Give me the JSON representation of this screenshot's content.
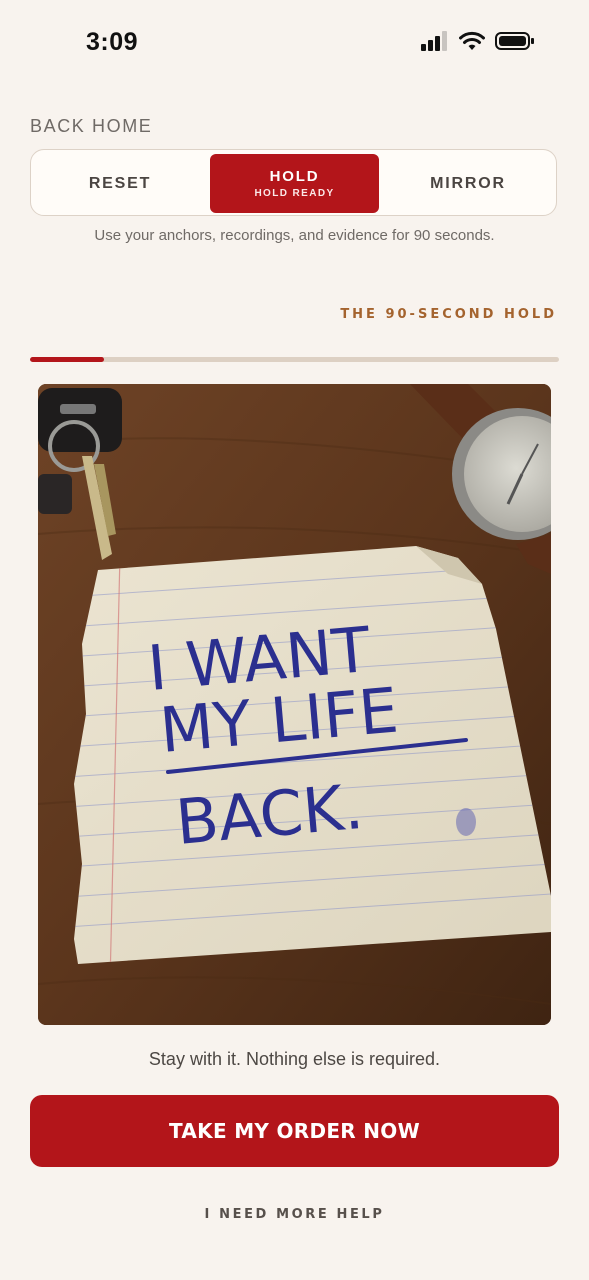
{
  "status_bar": {
    "time": "3:09"
  },
  "nav": {
    "back_label": "BACK HOME"
  },
  "modes": {
    "reset_label": "RESET",
    "hold_label": "HOLD",
    "hold_status": "HOLD READY",
    "mirror_label": "MIRROR",
    "selected": "HOLD"
  },
  "helper_text": "Use your anchors, recordings, and evidence for 90 seconds.",
  "hold_section": {
    "title": "THE 90-SECOND HOLD",
    "progress_fraction": 0.14
  },
  "anchor_image": {
    "note_lines": [
      "I WANT",
      "MY LIFE",
      "BACK."
    ]
  },
  "caption": "Stay with it. Nothing else is required.",
  "primary_button": {
    "label": "TAKE MY ORDER NOW"
  },
  "secondary_link": {
    "label": "I NEED MORE HELP"
  },
  "colors": {
    "accent": "#b3151a",
    "background": "#f8f3ee",
    "section_title": "#a4632e",
    "progress_track": "#ddd0c3"
  },
  "icons": [
    "cellular-signal-icon",
    "wifi-icon",
    "battery-icon"
  ]
}
